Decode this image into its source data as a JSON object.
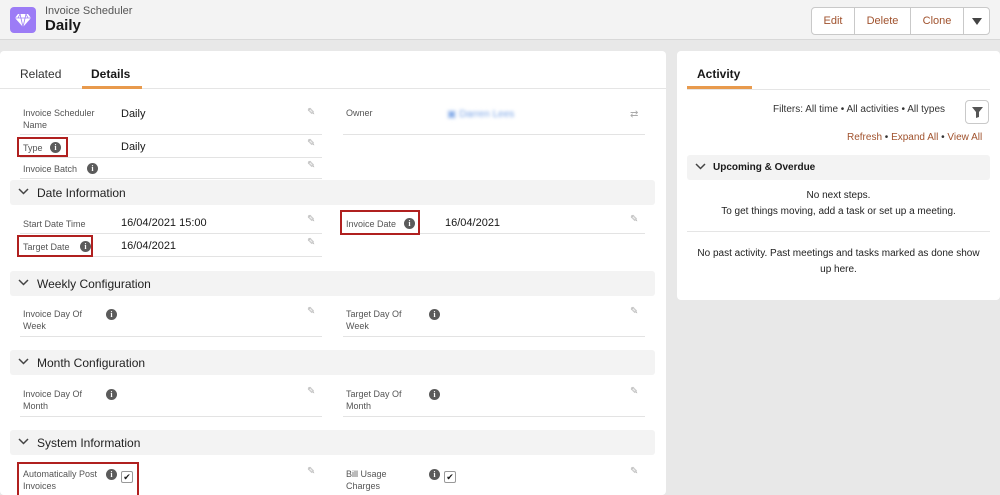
{
  "header": {
    "object_label": "Invoice Scheduler",
    "record_title": "Daily",
    "actions": {
      "edit": "Edit",
      "delete": "Delete",
      "clone": "Clone"
    }
  },
  "tabs": {
    "related": "Related",
    "details": "Details"
  },
  "fields": {
    "scheduler_name": {
      "label": "Invoice Scheduler Name",
      "value": "Daily"
    },
    "owner": {
      "label": "Owner",
      "value": "Darren Lees"
    },
    "type": {
      "label": "Type",
      "value": "Daily"
    },
    "invoice_batch": {
      "label": "Invoice Batch",
      "value": ""
    },
    "start_date_time": {
      "label": "Start Date Time",
      "value": "16/04/2021 15:00"
    },
    "invoice_date": {
      "label": "Invoice Date",
      "value": "16/04/2021"
    },
    "target_date": {
      "label": "Target Date",
      "value": "16/04/2021"
    },
    "weekly_invoice_day": {
      "label": "Invoice Day Of Week",
      "value": ""
    },
    "weekly_target_day": {
      "label": "Target Day Of Week",
      "value": ""
    },
    "monthly_invoice_day": {
      "label": "Invoice Day Of Month",
      "value": ""
    },
    "monthly_target_day": {
      "label": "Target Day Of Month",
      "value": ""
    },
    "auto_post": {
      "label": "Automatically Post Invoices",
      "checked": true
    },
    "bill_usage": {
      "label": "Bill Usage Charges",
      "checked": true
    }
  },
  "sections": {
    "date_info": "Date Information",
    "weekly": "Weekly Configuration",
    "monthly": "Month Configuration",
    "system": "System Information"
  },
  "activity": {
    "title": "Activity",
    "filters": "Filters: All time • All activities • All types",
    "refresh": "Refresh",
    "expand_all": "Expand All",
    "view_all": "View All",
    "upcoming_title": "Upcoming & Overdue",
    "no_next_steps": "No next steps.",
    "get_moving": "To get things moving, add a task or set up a meeting.",
    "no_past_1": "No past activity. Past meetings and tasks marked as done show",
    "no_past_2": "up here."
  },
  "colors": {
    "accent": "#e89a4d",
    "highlight_box": "#b0201f",
    "app_icon": "#9c7cf6"
  }
}
